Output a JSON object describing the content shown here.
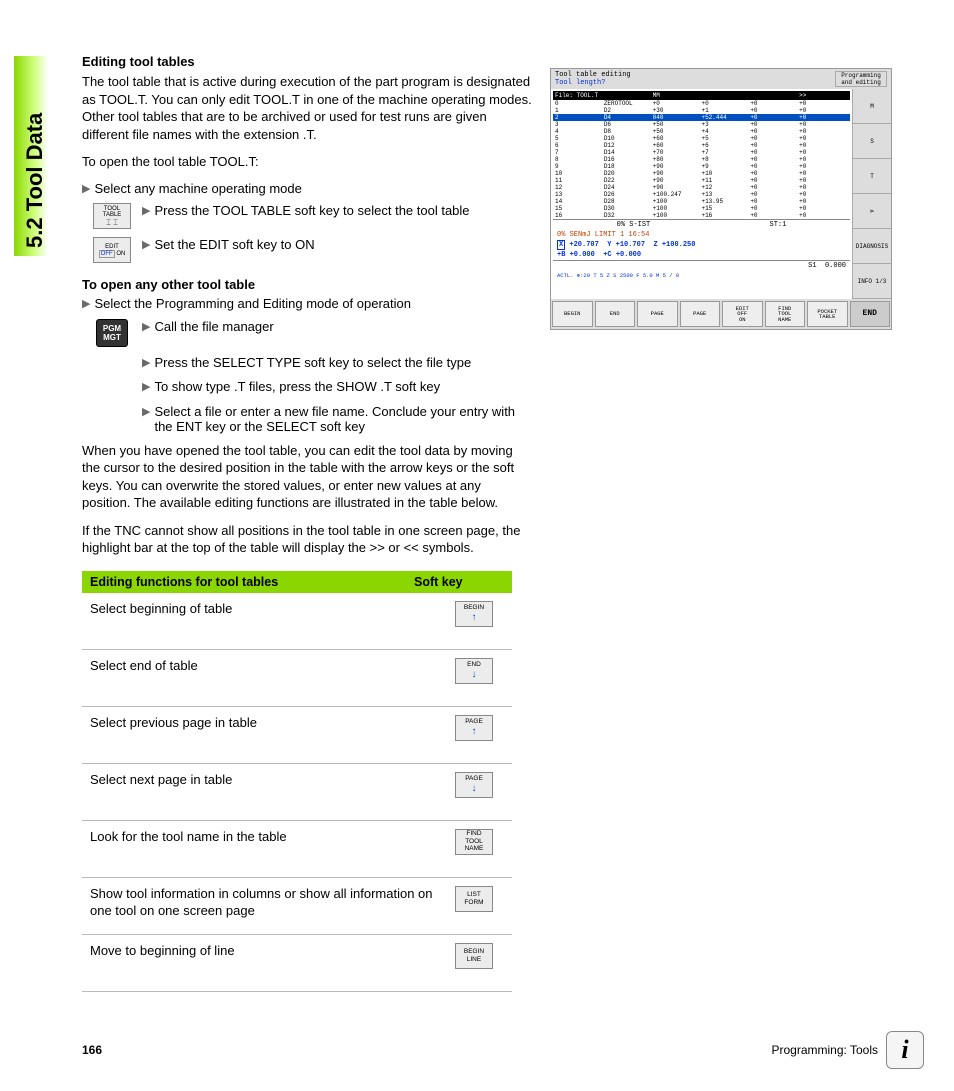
{
  "section_label": "5.2 Tool Data",
  "heading1": "Editing tool tables",
  "para1": "The tool table that is active during execution of the part program is designated as TOOL.T. You can only edit TOOL.T in one of the machine operating modes. Other tool tables that are to be archived or used for test runs are given different file names with the extension .T.",
  "para2": "To open the tool table TOOL.T:",
  "bullet1": "Select any machine operating mode",
  "softkey_tool_table": "TOOL TABLE",
  "step1": "Press the TOOL TABLE soft key to select the tool table",
  "softkey_edit": "EDIT",
  "softkey_edit_off": "OFF",
  "softkey_edit_on": "ON",
  "step2": "Set the EDIT soft key to ON",
  "heading2": "To open any other tool table",
  "bullet2": "Select the Programming and Editing mode of operation",
  "softkey_pgm": "PGM",
  "softkey_mgt": "MGT",
  "step3": "Call the file manager",
  "step4": "Press the SELECT TYPE soft key to select the file type",
  "step5": "To show type .T files, press the SHOW .T soft key",
  "step6": "Select a file or enter a new file name. Conclude your entry with the ENT key or the SELECT soft key",
  "para3": "When you have opened the tool table, you can edit the tool data by moving the cursor to the desired position in the table with the arrow keys or the soft keys. You can overwrite the stored values, or enter new values at any position. The available editing functions are illustrated in the table below.",
  "para4": "If the TNC cannot show all positions in the tool table in one screen page, the highlight bar at the top of the table will display the >> or << symbols.",
  "table_header1": "Editing functions for tool tables",
  "table_header2": "Soft key",
  "rows": [
    {
      "desc": "Select beginning of table",
      "sk_line1": "BEGIN",
      "sk_arrow": "↑"
    },
    {
      "desc": "Select end of table",
      "sk_line1": "END",
      "sk_arrow": "↓"
    },
    {
      "desc": "Select previous page in table",
      "sk_line1": "PAGE",
      "sk_arrow": "↑"
    },
    {
      "desc": "Select next page in table",
      "sk_line1": "PAGE",
      "sk_arrow": "↓"
    },
    {
      "desc": "Look for the tool name in the table",
      "sk_line1": "FIND",
      "sk_line2": "TOOL",
      "sk_line3": "NAME"
    },
    {
      "desc": "Show tool information in columns or show all information on one tool on one screen page",
      "sk_line1": "LIST",
      "sk_line2": "FORM"
    },
    {
      "desc": "Move to beginning of line",
      "sk_line1": "BEGIN",
      "sk_line2": "LINE"
    }
  ],
  "screenshot": {
    "title_left": "Tool table editing",
    "title_sub": "Tool length?",
    "title_right": "Programming and editing",
    "file_label": "File: TOOL.T",
    "cols": [
      "MM",
      "",
      "",
      "",
      ">>"
    ],
    "data_rows": [
      [
        "0",
        "ZEROTOOL",
        "+0",
        "+0",
        "+0",
        "+0"
      ],
      [
        "1",
        "D2",
        "+30",
        "+1",
        "+0",
        "+0"
      ],
      [
        "2",
        "D4",
        "040",
        "+52.444",
        "+0",
        "+0"
      ],
      [
        "3",
        "D6",
        "+50",
        "+3",
        "+0",
        "+0"
      ],
      [
        "4",
        "D8",
        "+50",
        "+4",
        "+0",
        "+0"
      ],
      [
        "5",
        "D10",
        "+60",
        "+5",
        "+0",
        "+0"
      ],
      [
        "6",
        "D12",
        "+60",
        "+6",
        "+0",
        "+0"
      ],
      [
        "7",
        "D14",
        "+70",
        "+7",
        "+0",
        "+0"
      ],
      [
        "8",
        "D16",
        "+80",
        "+8",
        "+0",
        "+0"
      ],
      [
        "9",
        "D18",
        "+90",
        "+9",
        "+0",
        "+0"
      ],
      [
        "10",
        "D20",
        "+90",
        "+10",
        "+0",
        "+0"
      ],
      [
        "11",
        "D22",
        "+90",
        "+11",
        "+0",
        "+0"
      ],
      [
        "12",
        "D24",
        "+90",
        "+12",
        "+0",
        "+0"
      ],
      [
        "13",
        "D26",
        "+100.247",
        "+13",
        "+0",
        "+0"
      ],
      [
        "14",
        "D28",
        "+100",
        "+13.95",
        "+0",
        "+0"
      ],
      [
        "15",
        "D30",
        "+100",
        "+15",
        "+0",
        "+0"
      ],
      [
        "16",
        "D32",
        "+100",
        "+16",
        "+0",
        "+0"
      ]
    ],
    "status1": "0% S-IST",
    "status2": "ST:1",
    "status3": "0% SENmJ LIMIT 1 16:54",
    "coord_x_label": "X",
    "coord_x": "+20.707",
    "coord_y_label": "Y",
    "coord_y": "+10.707",
    "coord_z_label": "Z",
    "coord_z": "+100.250",
    "coord_b_label": "+B",
    "coord_b": "+0.000",
    "coord_c_label": "+C",
    "coord_c": "+0.000",
    "s1_label": "S1",
    "s1_val": "0.000",
    "bottom_line": "ACTL.      ⊕:20       T 5       Z S 2500       F 5.0       M 5 / 0",
    "side_buttons": [
      "M",
      "S",
      "T",
      "⊳",
      "DIAGNOSIS",
      "INFO 1/3"
    ],
    "softkeys": [
      "BEGIN",
      "END",
      "PAGE",
      "PAGE",
      "EDIT OFF ON",
      "FIND TOOL NAME",
      "POCKET TABLE",
      "END"
    ]
  },
  "page_number": "166",
  "footer_text": "Programming: Tools",
  "info_glyph": "i"
}
